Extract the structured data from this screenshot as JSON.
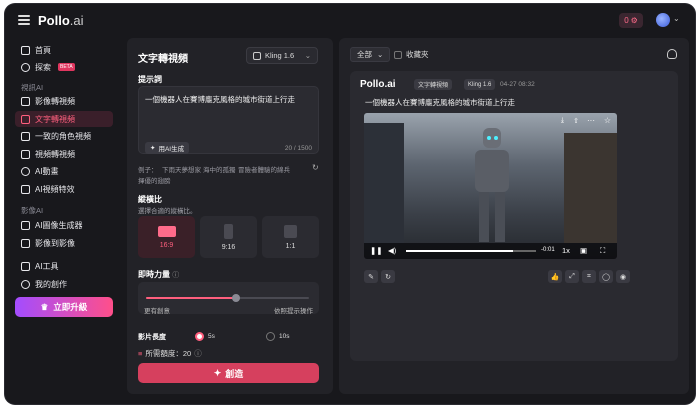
{
  "header": {
    "logo_name": "Pollo",
    "logo_suffix": ".ai",
    "credits": "0"
  },
  "sidebar": {
    "items_top": [
      {
        "label": "首頁"
      },
      {
        "label": "探索"
      }
    ],
    "beta_badge": "BETA",
    "section_video": "視訊AI",
    "video_items": [
      {
        "label": "影像轉視頻"
      },
      {
        "label": "文字轉視頻"
      },
      {
        "label": "一致的角色視頻"
      },
      {
        "label": "視頻轉視頻"
      },
      {
        "label": "AI動畫"
      },
      {
        "label": "AI視頻特效"
      }
    ],
    "section_image": "影像AI",
    "image_items": [
      {
        "label": "AI圖像生成器"
      },
      {
        "label": "影像到影像"
      }
    ],
    "bottom_items": [
      {
        "label": "AI工具"
      },
      {
        "label": "我的創作"
      }
    ],
    "upgrade": "立即升級"
  },
  "form": {
    "title": "文字轉視頻",
    "model": "Kling 1.6",
    "prompt_label": "提示詞",
    "prompt_value": "一個機器人在賽博龐克風格的城市街道上行走",
    "ai_generate": "用AI生成",
    "counter": "20 / 1500",
    "examples_label": "例子：",
    "examples": [
      "下雨天夢想家",
      "海中的孤獨",
      "冒險者體驗的綿兵",
      "揮優的翅膀"
    ],
    "ratio_label": "縱橫比",
    "ratio_sub": "選擇合適的縱橫比。",
    "ratios": [
      {
        "label": "16:9"
      },
      {
        "label": "9:16"
      },
      {
        "label": "1:1"
      }
    ],
    "motion_label": "即時力量",
    "motion_value": 0.55,
    "motion_left": "更有創意",
    "motion_right": "依照提示操作",
    "length_label": "影片長度",
    "length_options": [
      "5s",
      "10s"
    ],
    "cost": "所需額度：20",
    "create": "創造"
  },
  "results": {
    "filter": "全部",
    "favorites": "收藏夾",
    "card": {
      "brand": "Pollo.ai",
      "tags": [
        "文字轉視頻",
        "Kling 1.6"
      ],
      "date": "04-27 08:32",
      "prompt": "一個機器人在賽博龐克風格的城市街道上行走",
      "time_remaining": "-0:01",
      "speed": "1x",
      "progress": 0.82
    }
  },
  "colors": {
    "accent": "#ff5f7e",
    "create": "#d6405e",
    "bg": "#18181c",
    "panel": "#222227"
  }
}
